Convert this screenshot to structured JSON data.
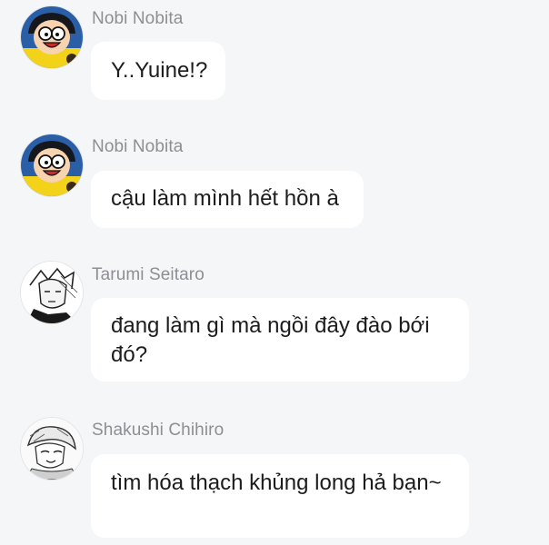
{
  "messages": [
    {
      "sender": "Nobi Nobita",
      "text": "Y..Yuine!?",
      "avatar": "nobita-avatar"
    },
    {
      "sender": "Nobi Nobita",
      "text": "cậu làm mình hết hồn à",
      "avatar": "nobita-avatar"
    },
    {
      "sender": "Tarumi Seitaro",
      "text": "đang làm gì mà ngồi đây đào bới đó?",
      "avatar": "tarumi-avatar"
    },
    {
      "sender": "Shakushi Chihiro",
      "text": "tìm hóa thạch khủng long hả bạn~",
      "avatar": "chihiro-avatar"
    }
  ],
  "colors": {
    "background": "#f5f6f8",
    "bubble": "#ffffff",
    "name_text": "#8e8e93",
    "message_text": "#1c1c1e"
  }
}
